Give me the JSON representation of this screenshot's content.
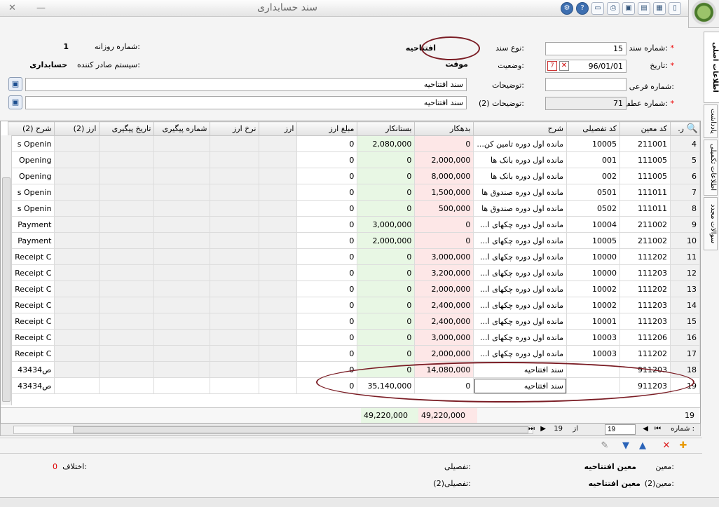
{
  "window": {
    "title": "سند حسابداری",
    "close_glyph": "✕",
    "minimize_glyph": "—"
  },
  "toolbar_icons": [
    "doc-icon",
    "save-icon",
    "save-as-icon",
    "save-all-icon",
    "print-preview-icon",
    "print-icon",
    "help-icon",
    "settings-icon"
  ],
  "header": {
    "doc_no_label": "شماره سند:",
    "doc_no_value": "15",
    "doc_type_label": "نوع سند:",
    "doc_type_value": "افتتاحیه",
    "daily_no_label": "شماره روزانه:",
    "daily_no_value": "1",
    "date_label": "تاریخ:",
    "date_value": "96/01/01",
    "status_label": "وضعیت:",
    "status_value": "موقت",
    "issuer_label": "سیستم صادر کننده:",
    "issuer_value": "حسابداری",
    "sub_no_label": "شماره فرعی:",
    "sub_no_value": "",
    "desc_label": "توضیحات:",
    "desc_value": "سند افتتاحیه",
    "ref_no_label": "شماره عطف:",
    "ref_no_value": "71",
    "desc2_label": "توضیحات (2):",
    "desc2_value": "سند افتتاحیه"
  },
  "side_tabs": [
    "اطلاعات اصلی",
    "یادداشت",
    "اطلاعات تکمیلی",
    "سوالات مجدد"
  ],
  "grid": {
    "columns": [
      "ر.",
      "کد معین",
      "کد تفصیلی",
      "شرح",
      "بدهکار",
      "بستانکار",
      "مبلغ ارز",
      "ارز",
      "نرخ ارز",
      "شماره پیگیری",
      "تاریخ پیگیری",
      "ارز (2)",
      "شرح (2)"
    ],
    "rows": [
      [
        "4",
        "211001",
        "10005",
        "مانده اول دوره تامین کن...",
        "0",
        "2,080,000",
        "0",
        "",
        "",
        "",
        "",
        "",
        "s Openin"
      ],
      [
        "5",
        "111005",
        "001",
        "مانده اول دوره بانک ها",
        "2,000,000",
        "0",
        "0",
        "",
        "",
        "",
        "",
        "",
        "Opening"
      ],
      [
        "6",
        "111005",
        "002",
        "مانده اول دوره بانک ها",
        "8,000,000",
        "0",
        "0",
        "",
        "",
        "",
        "",
        "",
        "Opening"
      ],
      [
        "7",
        "111011",
        "0501",
        "مانده اول دوره صندوق ها",
        "1,500,000",
        "0",
        "0",
        "",
        "",
        "",
        "",
        "",
        "s Openin"
      ],
      [
        "8",
        "111011",
        "0502",
        "مانده اول دوره صندوق ها",
        "500,000",
        "0",
        "0",
        "",
        "",
        "",
        "",
        "",
        "s Openin"
      ],
      [
        "9",
        "211002",
        "10004",
        "مانده اول دوره چکهای ا...",
        "0",
        "3,000,000",
        "0",
        "",
        "",
        "",
        "",
        "",
        "Payment"
      ],
      [
        "10",
        "211002",
        "10005",
        "مانده اول دوره چکهای ا...",
        "0",
        "2,000,000",
        "0",
        "",
        "",
        "",
        "",
        "",
        "Payment"
      ],
      [
        "11",
        "111202",
        "10000",
        "مانده اول دوره چکهای ا...",
        "3,000,000",
        "0",
        "0",
        "",
        "",
        "",
        "",
        "",
        "Receipt C"
      ],
      [
        "12",
        "111203",
        "10000",
        "مانده اول دوره چکهای ا...",
        "3,200,000",
        "0",
        "0",
        "",
        "",
        "",
        "",
        "",
        "Receipt C"
      ],
      [
        "13",
        "111202",
        "10002",
        "مانده اول دوره چکهای ا...",
        "2,000,000",
        "0",
        "0",
        "",
        "",
        "",
        "",
        "",
        "Receipt C"
      ],
      [
        "14",
        "111203",
        "10002",
        "مانده اول دوره چکهای ا...",
        "2,400,000",
        "0",
        "0",
        "",
        "",
        "",
        "",
        "",
        "Receipt C"
      ],
      [
        "15",
        "111203",
        "10001",
        "مانده اول دوره چکهای ا...",
        "2,400,000",
        "0",
        "0",
        "",
        "",
        "",
        "",
        "",
        "Receipt C"
      ],
      [
        "16",
        "111206",
        "10003",
        "مانده اول دوره چکهای ا...",
        "3,000,000",
        "0",
        "0",
        "",
        "",
        "",
        "",
        "",
        "Receipt C"
      ],
      [
        "17",
        "111202",
        "10003",
        "مانده اول دوره چکهای ا...",
        "2,000,000",
        "0",
        "0",
        "",
        "",
        "",
        "",
        "",
        "Receipt C"
      ],
      [
        "18",
        "911203",
        "",
        "سند افتتاحیه",
        "14,080,000",
        "0",
        "0",
        "",
        "",
        "",
        "",
        "",
        "ص43434"
      ],
      [
        "19",
        "911203",
        "",
        "سند افتتاحیه",
        "0",
        "35,140,000",
        "0",
        "",
        "",
        "",
        "",
        "",
        "ص43434"
      ]
    ],
    "totals": {
      "count": "19",
      "debit": "49,220,000",
      "credit": "49,220,000"
    }
  },
  "pager": {
    "label": "شماره :",
    "current": "19",
    "of_label": "از",
    "total": "19"
  },
  "footer": {
    "moein_label": "معین:",
    "moein_value": "معین افتتاحیه",
    "tafsili_label": "تفصیلی:",
    "moein2_label": "معین(2):",
    "moein2_value": "معین افتتاحیه",
    "tafsili2_label": "تفصیلی(2):",
    "diff_label": "اختلاف:",
    "diff_value": "0"
  },
  "colors": {
    "debit_bg": "#fde7e7",
    "credit_bg": "#e8f7e4",
    "annotation": "#7a1c24",
    "required": "#e00000"
  }
}
